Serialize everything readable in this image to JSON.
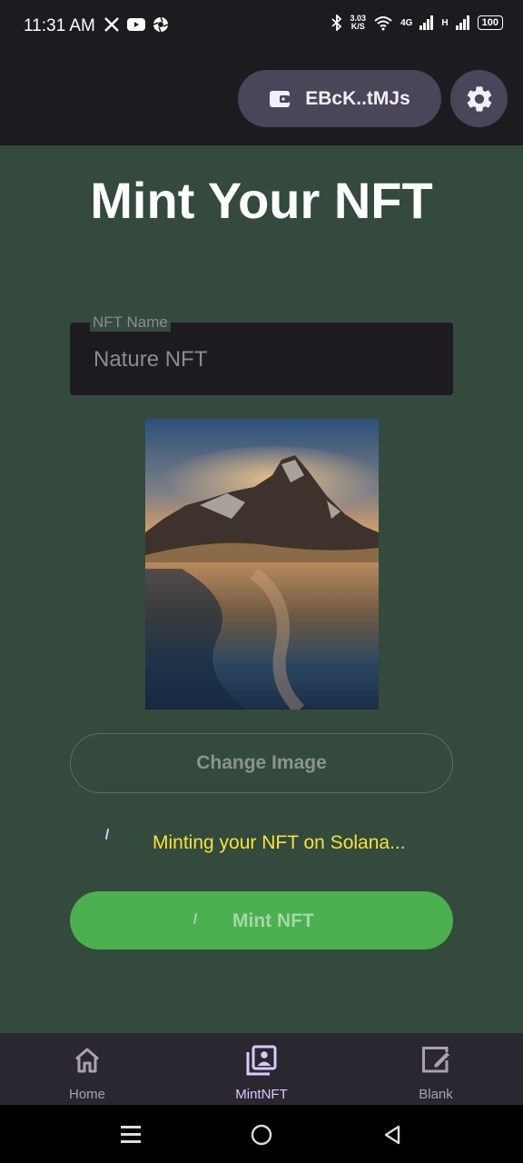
{
  "status_bar": {
    "time": "11:31 AM",
    "left_icons": [
      "x-icon",
      "youtube-icon",
      "aperture-icon"
    ],
    "net_speed_value": "3.03",
    "net_speed_unit": "K/S",
    "network_4g": "4G",
    "network_h": "H",
    "battery": "100"
  },
  "app_bar": {
    "wallet_address": "EBcK..tMJs",
    "wallet_icon": "wallet-icon",
    "settings_icon": "gear-icon"
  },
  "main": {
    "title": "Mint Your NFT",
    "nft_name_label": "NFT Name",
    "nft_name_value": "Nature NFT",
    "change_image_label": "Change Image",
    "status_text": "Minting your NFT on Solana...",
    "mint_button_label": "Mint NFT"
  },
  "bottom_nav": {
    "items": [
      {
        "label": "Home",
        "icon": "home-icon",
        "active": false
      },
      {
        "label": "MintNFT",
        "icon": "portrait-icon",
        "active": true
      },
      {
        "label": "Blank",
        "icon": "edit-square-icon",
        "active": false
      }
    ]
  },
  "colors": {
    "background": "#334a3c",
    "app_bar": "#1d1b20",
    "accent_green": "#4caf50",
    "status_yellow": "#f5e23a",
    "active_nav": "#dcc7ff"
  }
}
